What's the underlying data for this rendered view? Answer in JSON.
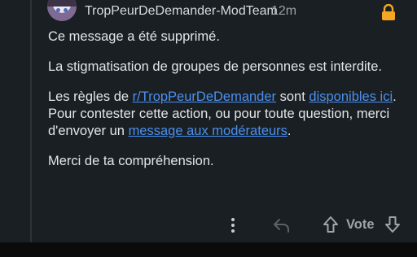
{
  "comment": {
    "author": "TropPeurDeDemander-ModTeam",
    "time": "12m",
    "paragraph1": "Ce message a été supprimé.",
    "paragraph2": "La stigmatisation de groupes de personnes est interdite.",
    "paragraph3": {
      "t1": "Les règles de ",
      "link1": "r/TropPeurDeDemander",
      "t2": " sont ",
      "link2": "disponibles ici",
      "t3": ". Pour contester cette action, ou pour toute question, merci d'envoyer un ",
      "link3": "message aux modérateurs",
      "t4": "."
    },
    "paragraph4": "Merci de ta compréhension."
  },
  "actions": {
    "vote_label": "Vote"
  },
  "icons": {
    "lock": "lock-icon",
    "more": "more-icon",
    "reply": "reply-icon",
    "upvote": "upvote-icon",
    "downvote": "downvote-icon"
  },
  "colors": {
    "background": "#1a1f23",
    "link": "#4a90f0",
    "lock": "#f5a623"
  }
}
